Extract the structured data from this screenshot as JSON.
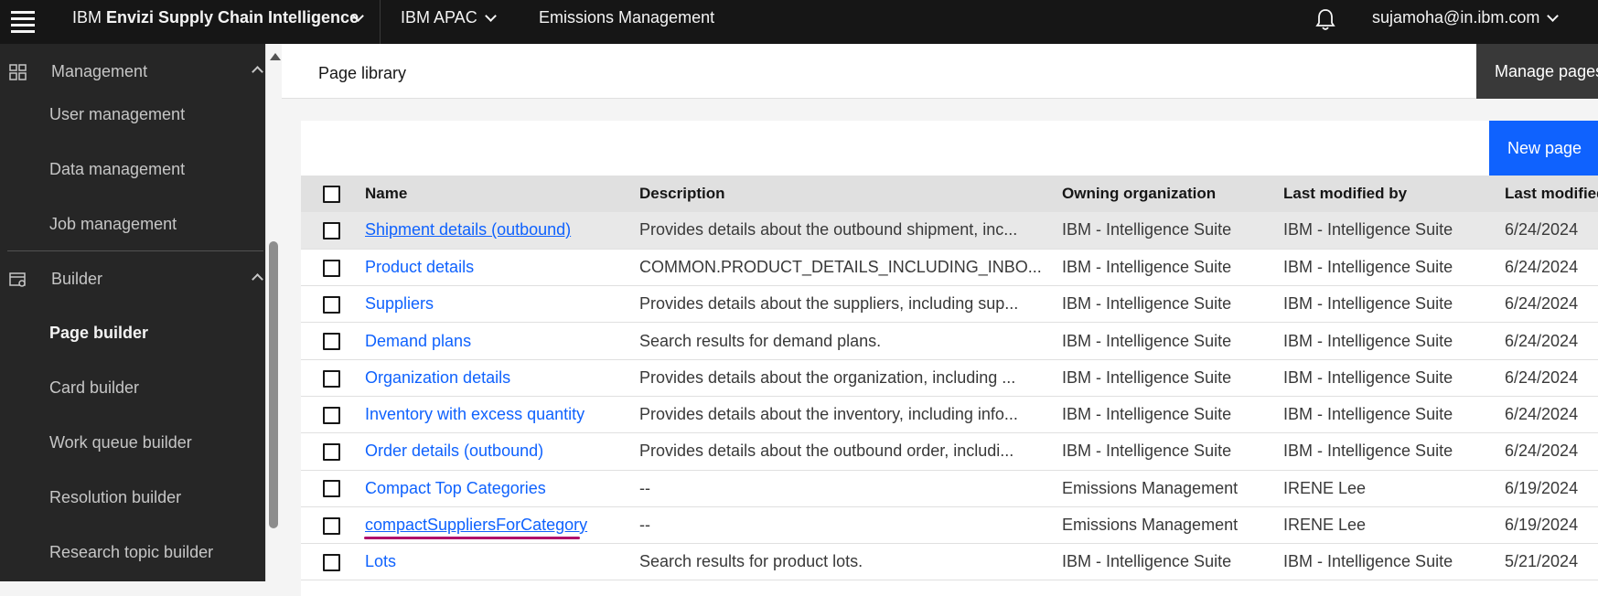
{
  "header": {
    "brand_prefix": "IBM",
    "brand_name": "Envizi Supply Chain Intelligence",
    "org": "IBM APAC",
    "module": "Emissions Management",
    "user": "sujamoha@in.ibm.com"
  },
  "sidebar": {
    "management_label": "Management",
    "management_items": [
      "User management",
      "Data management",
      "Job management"
    ],
    "builder_label": "Builder",
    "builder_items": [
      "Page builder",
      "Card builder",
      "Work queue builder",
      "Resolution builder",
      "Research topic builder"
    ]
  },
  "main": {
    "tab_label": "Page library",
    "manage_pages_label": "Manage pages",
    "new_page_label": "New page"
  },
  "table": {
    "headers": [
      "Name",
      "Description",
      "Owning organization",
      "Last modified by",
      "Last modified"
    ],
    "rows": [
      {
        "name": "Shipment details (outbound)",
        "description": "Provides details about the outbound shipment, inc...",
        "org": "IBM - Intelligence Suite",
        "modified_by": "IBM - Intelligence Suite",
        "date": "6/24/2024"
      },
      {
        "name": "Product details",
        "description": "COMMON.PRODUCT_DETAILS_INCLUDING_INBO...",
        "org": "IBM - Intelligence Suite",
        "modified_by": "IBM - Intelligence Suite",
        "date": "6/24/2024"
      },
      {
        "name": "Suppliers",
        "description": "Provides details about the suppliers, including sup...",
        "org": "IBM - Intelligence Suite",
        "modified_by": "IBM - Intelligence Suite",
        "date": "6/24/2024"
      },
      {
        "name": "Demand plans",
        "description": "Search results for demand plans.",
        "org": "IBM - Intelligence Suite",
        "modified_by": "IBM - Intelligence Suite",
        "date": "6/24/2024"
      },
      {
        "name": "Organization details",
        "description": "Provides details about the organization, including ...",
        "org": "IBM - Intelligence Suite",
        "modified_by": "IBM - Intelligence Suite",
        "date": "6/24/2024"
      },
      {
        "name": "Inventory with excess quantity",
        "description": "Provides details about the inventory, including info...",
        "org": "IBM - Intelligence Suite",
        "modified_by": "IBM - Intelligence Suite",
        "date": "6/24/2024"
      },
      {
        "name": "Order details (outbound)",
        "description": "Provides details about the outbound order, includi...",
        "org": "IBM - Intelligence Suite",
        "modified_by": "IBM - Intelligence Suite",
        "date": "6/24/2024"
      },
      {
        "name": "Compact Top Categories",
        "description": "--",
        "org": "Emissions Management",
        "modified_by": "IRENE Lee",
        "date": "6/19/2024"
      },
      {
        "name": "compactSuppliersForCategory",
        "description": "--",
        "org": "Emissions Management",
        "modified_by": "IRENE Lee",
        "date": "6/19/2024"
      },
      {
        "name": "Lots",
        "description": "Search results for product lots.",
        "org": "IBM - Intelligence Suite",
        "modified_by": "IBM - Intelligence Suite",
        "date": "5/21/2024"
      }
    ]
  }
}
